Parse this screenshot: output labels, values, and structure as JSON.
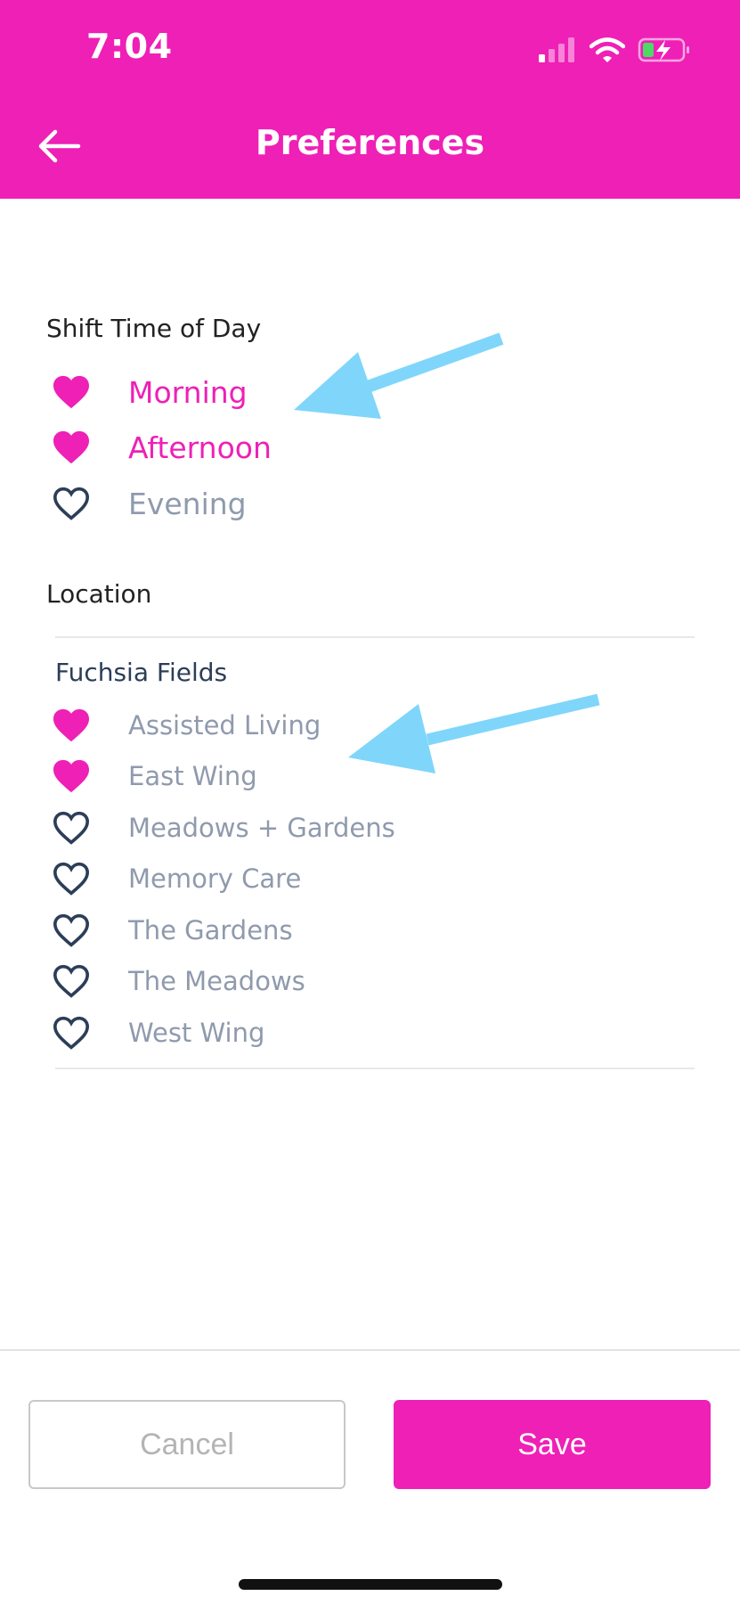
{
  "status_bar": {
    "time": "7:04"
  },
  "header": {
    "title": "Preferences"
  },
  "shift_section": {
    "title": "Shift Time of Day",
    "items": [
      {
        "label": "Morning",
        "selected": true
      },
      {
        "label": "Afternoon",
        "selected": true
      },
      {
        "label": "Evening",
        "selected": false
      }
    ]
  },
  "location_section": {
    "title": "Location",
    "group_title": "Fuchsia Fields",
    "items": [
      {
        "label": "Assisted Living",
        "selected": true
      },
      {
        "label": "East Wing",
        "selected": true
      },
      {
        "label": "Meadows + Gardens",
        "selected": false
      },
      {
        "label": "Memory Care",
        "selected": false
      },
      {
        "label": "The Gardens",
        "selected": false
      },
      {
        "label": "The Meadows",
        "selected": false
      },
      {
        "label": "West Wing",
        "selected": false
      }
    ]
  },
  "actions": {
    "cancel_label": "Cancel",
    "save_label": "Save"
  },
  "colors": {
    "brand": "#EE20B6",
    "unselected_text": "#8F9AAD",
    "heart_outline": "#2C3E57",
    "annotation_arrow": "#7FD6FA"
  },
  "icons": {
    "back": "arrow-left-icon",
    "selected": "heart-filled-icon",
    "unselected": "heart-outline-icon"
  }
}
